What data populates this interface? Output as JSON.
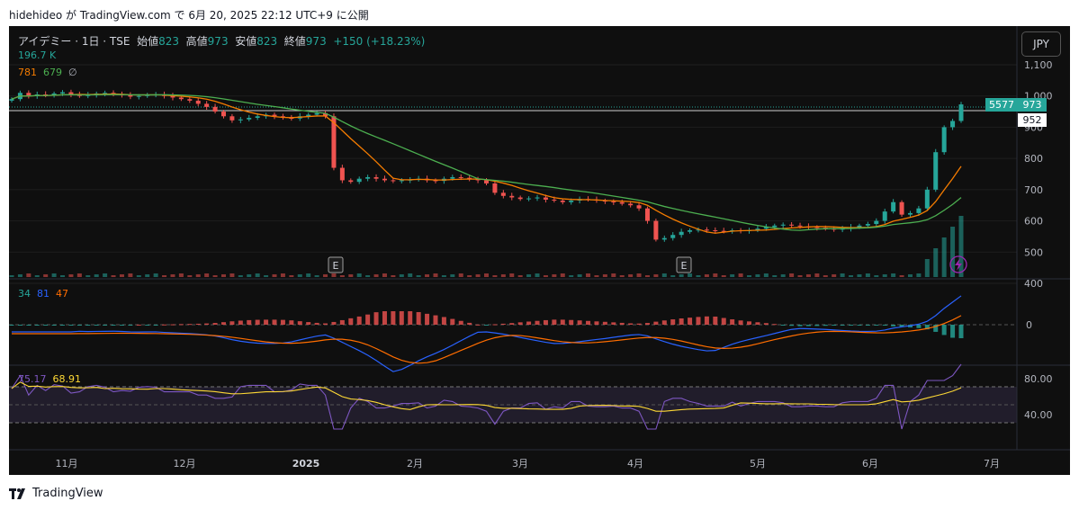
{
  "header": {
    "text": "hidehideo が TradingView.com で 6月 20, 2025 22:12 UTC+9 に公開"
  },
  "legend": {
    "symbol": "アイデミー · 1日 · TSE",
    "open_label": "始値",
    "open": "823",
    "high_label": "高値",
    "high": "973",
    "low_label": "安値",
    "low": "823",
    "close_label": "終値",
    "close": "973",
    "change": "+150 (+18.23%)",
    "volume": "196.7 K",
    "ma1": "781",
    "ma2": "679",
    "na_glyph": "∅"
  },
  "macd_legend": {
    "v1": "34",
    "v2": "81",
    "v3": "47"
  },
  "rsi_legend": {
    "v1": "75.17",
    "v2": "68.91"
  },
  "currency_button": "JPY",
  "price_labels": [
    "1,100",
    "1,000",
    "900",
    "800",
    "700",
    "600",
    "500",
    "400"
  ],
  "price_tags": {
    "volume_tag": "5577",
    "price_tag": "973",
    "low_tag": "952"
  },
  "macd_labels": [
    "0"
  ],
  "rsi_labels": [
    "80.00",
    "40.00"
  ],
  "time_labels": [
    "11月",
    "12月",
    "2025",
    "2月",
    "3月",
    "4月",
    "5月",
    "6月",
    "7月"
  ],
  "earnings_marker": "E",
  "footer": {
    "brand": "TradingView",
    "logo_icon": "tradingview-logo-icon"
  },
  "colors": {
    "up": "#26a69a",
    "down": "#ef5350",
    "ma_fast": "#f57c00",
    "ma_slow": "#4caf50",
    "macd": "#2962ff",
    "signal": "#ff6d00",
    "rsi": "#7e57c2",
    "rsi_ma": "#fdd835"
  },
  "chart_data": {
    "type": "candlestick",
    "symbol": "アイデミー · 1日 · TSE",
    "y_axis_range": [
      400,
      1150
    ],
    "last_price": 973,
    "close_series": [
      990,
      1010,
      1000,
      1005,
      1002,
      1008,
      1012,
      1005,
      1000,
      1003,
      1008,
      1010,
      1005,
      1002,
      998,
      1000,
      1003,
      1005,
      1000,
      995,
      990,
      985,
      975,
      965,
      950,
      935,
      922,
      925,
      930,
      935,
      940,
      935,
      930,
      928,
      935,
      940,
      945,
      935,
      770,
      730,
      725,
      735,
      740,
      735,
      730,
      728,
      730,
      732,
      735,
      730,
      728,
      735,
      740,
      738,
      735,
      730,
      720,
      690,
      680,
      675,
      670,
      672,
      675,
      668,
      665,
      660,
      665,
      670,
      668,
      665,
      662,
      660,
      655,
      650,
      640,
      600,
      540,
      545,
      555,
      565,
      570,
      572,
      570,
      568,
      566,
      570,
      568,
      570,
      575,
      580,
      585,
      588,
      585,
      582,
      580,
      578,
      575,
      572,
      575,
      580,
      585,
      590,
      600,
      630,
      660,
      620,
      625,
      640,
      700,
      820,
      900,
      920,
      973
    ]
  }
}
